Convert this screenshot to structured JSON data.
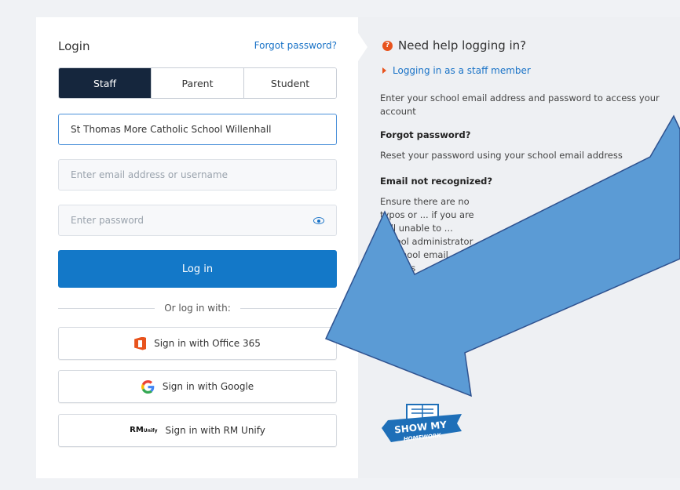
{
  "login": {
    "title": "Login",
    "forgot_password": "Forgot password?",
    "tabs": [
      {
        "label": "Staff",
        "active": true
      },
      {
        "label": "Parent",
        "active": false
      },
      {
        "label": "Student",
        "active": false
      }
    ],
    "school_value": "St Thomas More Catholic School  Willenhall",
    "email_placeholder": "Enter email address or username",
    "password_placeholder": "Enter password",
    "login_button": "Log in",
    "or_text": "Or log in with:",
    "sso": {
      "office365": "Sign in with Office 365",
      "google": "Sign in with Google",
      "rm_unify": "Sign in with RM Unify"
    },
    "rm_logo_top": "RM",
    "rm_logo_bottom": "Unify"
  },
  "help": {
    "title": "Need help logging in?",
    "link": "Logging in as a staff member",
    "intro": "Enter your school email address and password to access your account",
    "forgot_heading": "Forgot password?",
    "forgot_text": "Reset your password using your school email address",
    "email_heading": "Email not recognized?",
    "email_text": "Ensure there are no typos or ... if you are still unable to ... school administrator ... school email address"
  },
  "logo": {
    "line1": "SHOW MY",
    "line2": "HOMEWORK"
  },
  "colors": {
    "accent": "#1378c8",
    "tab_active": "#15263d",
    "help_icon": "#e8531d",
    "arrow_fill": "#5b9bd5",
    "arrow_stroke": "#2f528f"
  }
}
